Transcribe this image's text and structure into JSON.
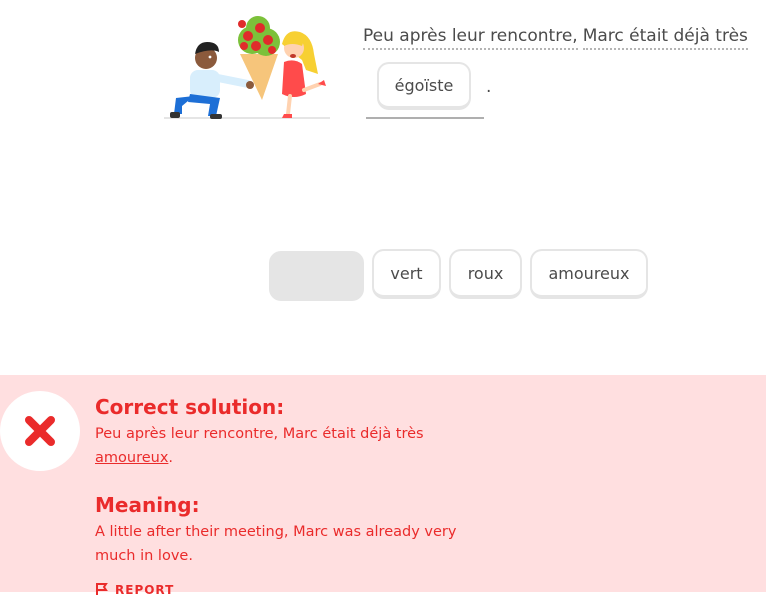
{
  "challenge": {
    "sentence_before": "Peu après leur rencontre,",
    "sentence_middle": "Marc était déjà très",
    "selected_answer": "égoïste",
    "sentence_end": "."
  },
  "word_bank": [
    "vert",
    "roux",
    "amoureux"
  ],
  "feedback": {
    "title": "Correct solution:",
    "solution_start": "Peu après leur rencontre, Marc était déjà très",
    "solution_word": "amoureux",
    "solution_end": ".",
    "meaning_title": "Meaning:",
    "meaning_text": "A little after their meeting, Marc was already very much in love.",
    "report_label": "REPORT"
  },
  "colors": {
    "error_red": "#ea2b2b",
    "feedback_bg": "#ffdfe0",
    "chip_border": "#e5e5e5"
  },
  "icons": {
    "feedback": "x-mark-icon",
    "report": "flag-icon"
  }
}
